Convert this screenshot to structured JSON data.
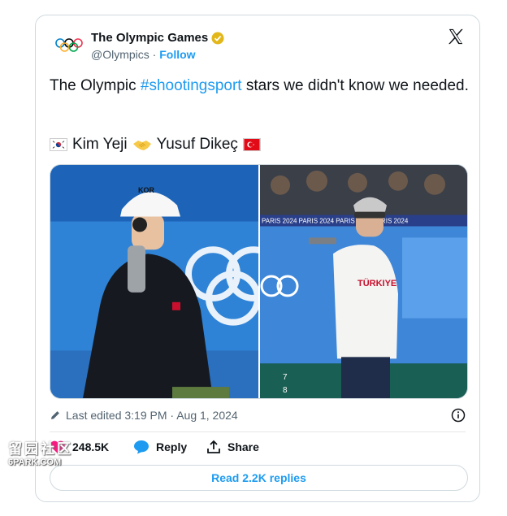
{
  "post": {
    "author_name": "The Olympic Games",
    "handle": "@Olympics",
    "separator": "·",
    "follow_label": "Follow",
    "text_before": "The Olympic ",
    "hashtag": "#shootingsport",
    "text_after": " stars we didn't know we needed.",
    "athlete_one": "Kim Yeji",
    "athlete_two": "Yusuf Dikeç",
    "edited_label": "Last edited 3:19 PM · Aug 1, 2024"
  },
  "media": {
    "left_cap_text": "KOR",
    "right_shirt_text": "TÜRKIYE",
    "banner_text": "PARIS 2024  PARIS 2024  PARIS 2024  PARIS 2024",
    "lane_numbers": [
      "7",
      "8"
    ]
  },
  "actions": {
    "likes_count": "248.5K",
    "reply_label": "Reply",
    "share_label": "Share"
  },
  "footer": {
    "read_replies_label": "Read 2.2K replies"
  },
  "watermark": {
    "top": "留园社区",
    "bottom": "6PARK.COM"
  },
  "colors": {
    "accent": "#1d9bf0",
    "like_red": "#f91880",
    "verified_gold": "#e2b719",
    "text": "#0f1419",
    "muted": "#536471"
  }
}
